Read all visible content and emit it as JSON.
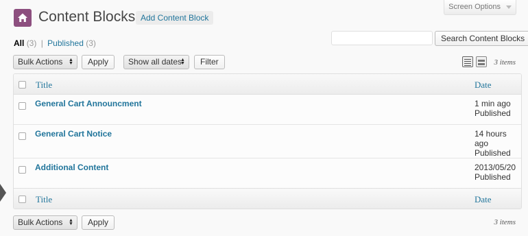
{
  "screen_options": {
    "label": "Screen Options"
  },
  "header": {
    "title": "Content Blocks",
    "add_new_label": "Add Content Block"
  },
  "filters": {
    "all_label": "All",
    "all_count": "(3)",
    "separator": "|",
    "published_label": "Published",
    "published_count": "(3)"
  },
  "search": {
    "value": "",
    "button_label": "Search Content Blocks"
  },
  "toolbar_top": {
    "bulk_actions": "Bulk Actions",
    "apply": "Apply",
    "dates": "Show all dates",
    "filter": "Filter",
    "items_count": "3 items"
  },
  "table": {
    "columns": {
      "title": "Title",
      "date": "Date"
    },
    "rows": [
      {
        "title": "General Cart Announcment",
        "date_line1": "1 min ago",
        "date_line2": "Published"
      },
      {
        "title": "General Cart Notice",
        "date_line1": "14 hours ago",
        "date_line2": "Published"
      },
      {
        "title": "Additional Content",
        "date_line1": "2013/05/20",
        "date_line2": "Published"
      }
    ]
  },
  "toolbar_bottom": {
    "bulk_actions": "Bulk Actions",
    "apply": "Apply",
    "items_count": "3 items"
  },
  "icons": {
    "page_icon": "house-icon",
    "list_view": "list-view-icon",
    "excerpt_view": "excerpt-view-icon"
  },
  "colors": {
    "accent": "#21759b",
    "page_icon_bg": "#8d4f7f"
  }
}
